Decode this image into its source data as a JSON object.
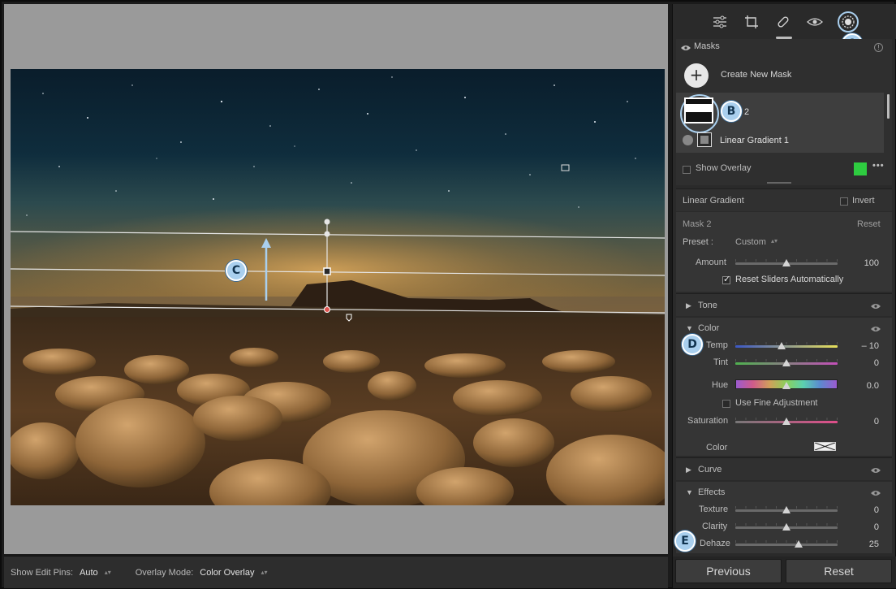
{
  "toolbar": {
    "edit_pins_label": "Show Edit Pins:",
    "edit_pins_value": "Auto",
    "overlay_mode_label": "Overlay Mode:",
    "overlay_mode_value": "Color Overlay"
  },
  "tools": {
    "items": [
      "edit-sliders-icon",
      "crop-icon",
      "healing-icon",
      "red-eye-icon",
      "masking-icon"
    ]
  },
  "masks": {
    "header": "Masks",
    "create_label": "Create New Mask",
    "mask_number": "2",
    "component_label": "Linear Gradient 1",
    "show_overlay_label": "Show Overlay",
    "overlay_color": "#2ecc40"
  },
  "linear_gradient": {
    "title": "Linear Gradient",
    "invert_label": "Invert"
  },
  "mask_settings": {
    "name": "Mask 2",
    "reset_label": "Reset",
    "preset_label": "Preset :",
    "preset_value": "Custom",
    "amount_label": "Amount",
    "amount_value": "100",
    "amount_fraction": 0.5,
    "reset_sliders_label": "Reset Sliders Automatically"
  },
  "tone": {
    "title": "Tone"
  },
  "color": {
    "title": "Color",
    "temp_label": "Temp",
    "temp_value": "– 10",
    "temp_fraction": 0.45,
    "tint_label": "Tint",
    "tint_value": "0",
    "tint_fraction": 0.5,
    "hue_label": "Hue",
    "hue_value": "0.0",
    "hue_fraction": 0.5,
    "fine_adjust_label": "Use Fine Adjustment",
    "saturation_label": "Saturation",
    "saturation_value": "0",
    "saturation_fraction": 0.5,
    "color_label": "Color"
  },
  "curve": {
    "title": "Curve"
  },
  "effects": {
    "title": "Effects",
    "texture_label": "Texture",
    "texture_value": "0",
    "texture_fraction": 0.5,
    "clarity_label": "Clarity",
    "clarity_value": "0",
    "clarity_fraction": 0.5,
    "dehaze_label": "Dehaze",
    "dehaze_value": "25",
    "dehaze_fraction": 0.62
  },
  "buttons": {
    "previous_label": "Previous",
    "reset_label": "Reset"
  },
  "callouts": {
    "a": "A",
    "b": "B",
    "c": "C",
    "d": "D",
    "e": "E"
  }
}
